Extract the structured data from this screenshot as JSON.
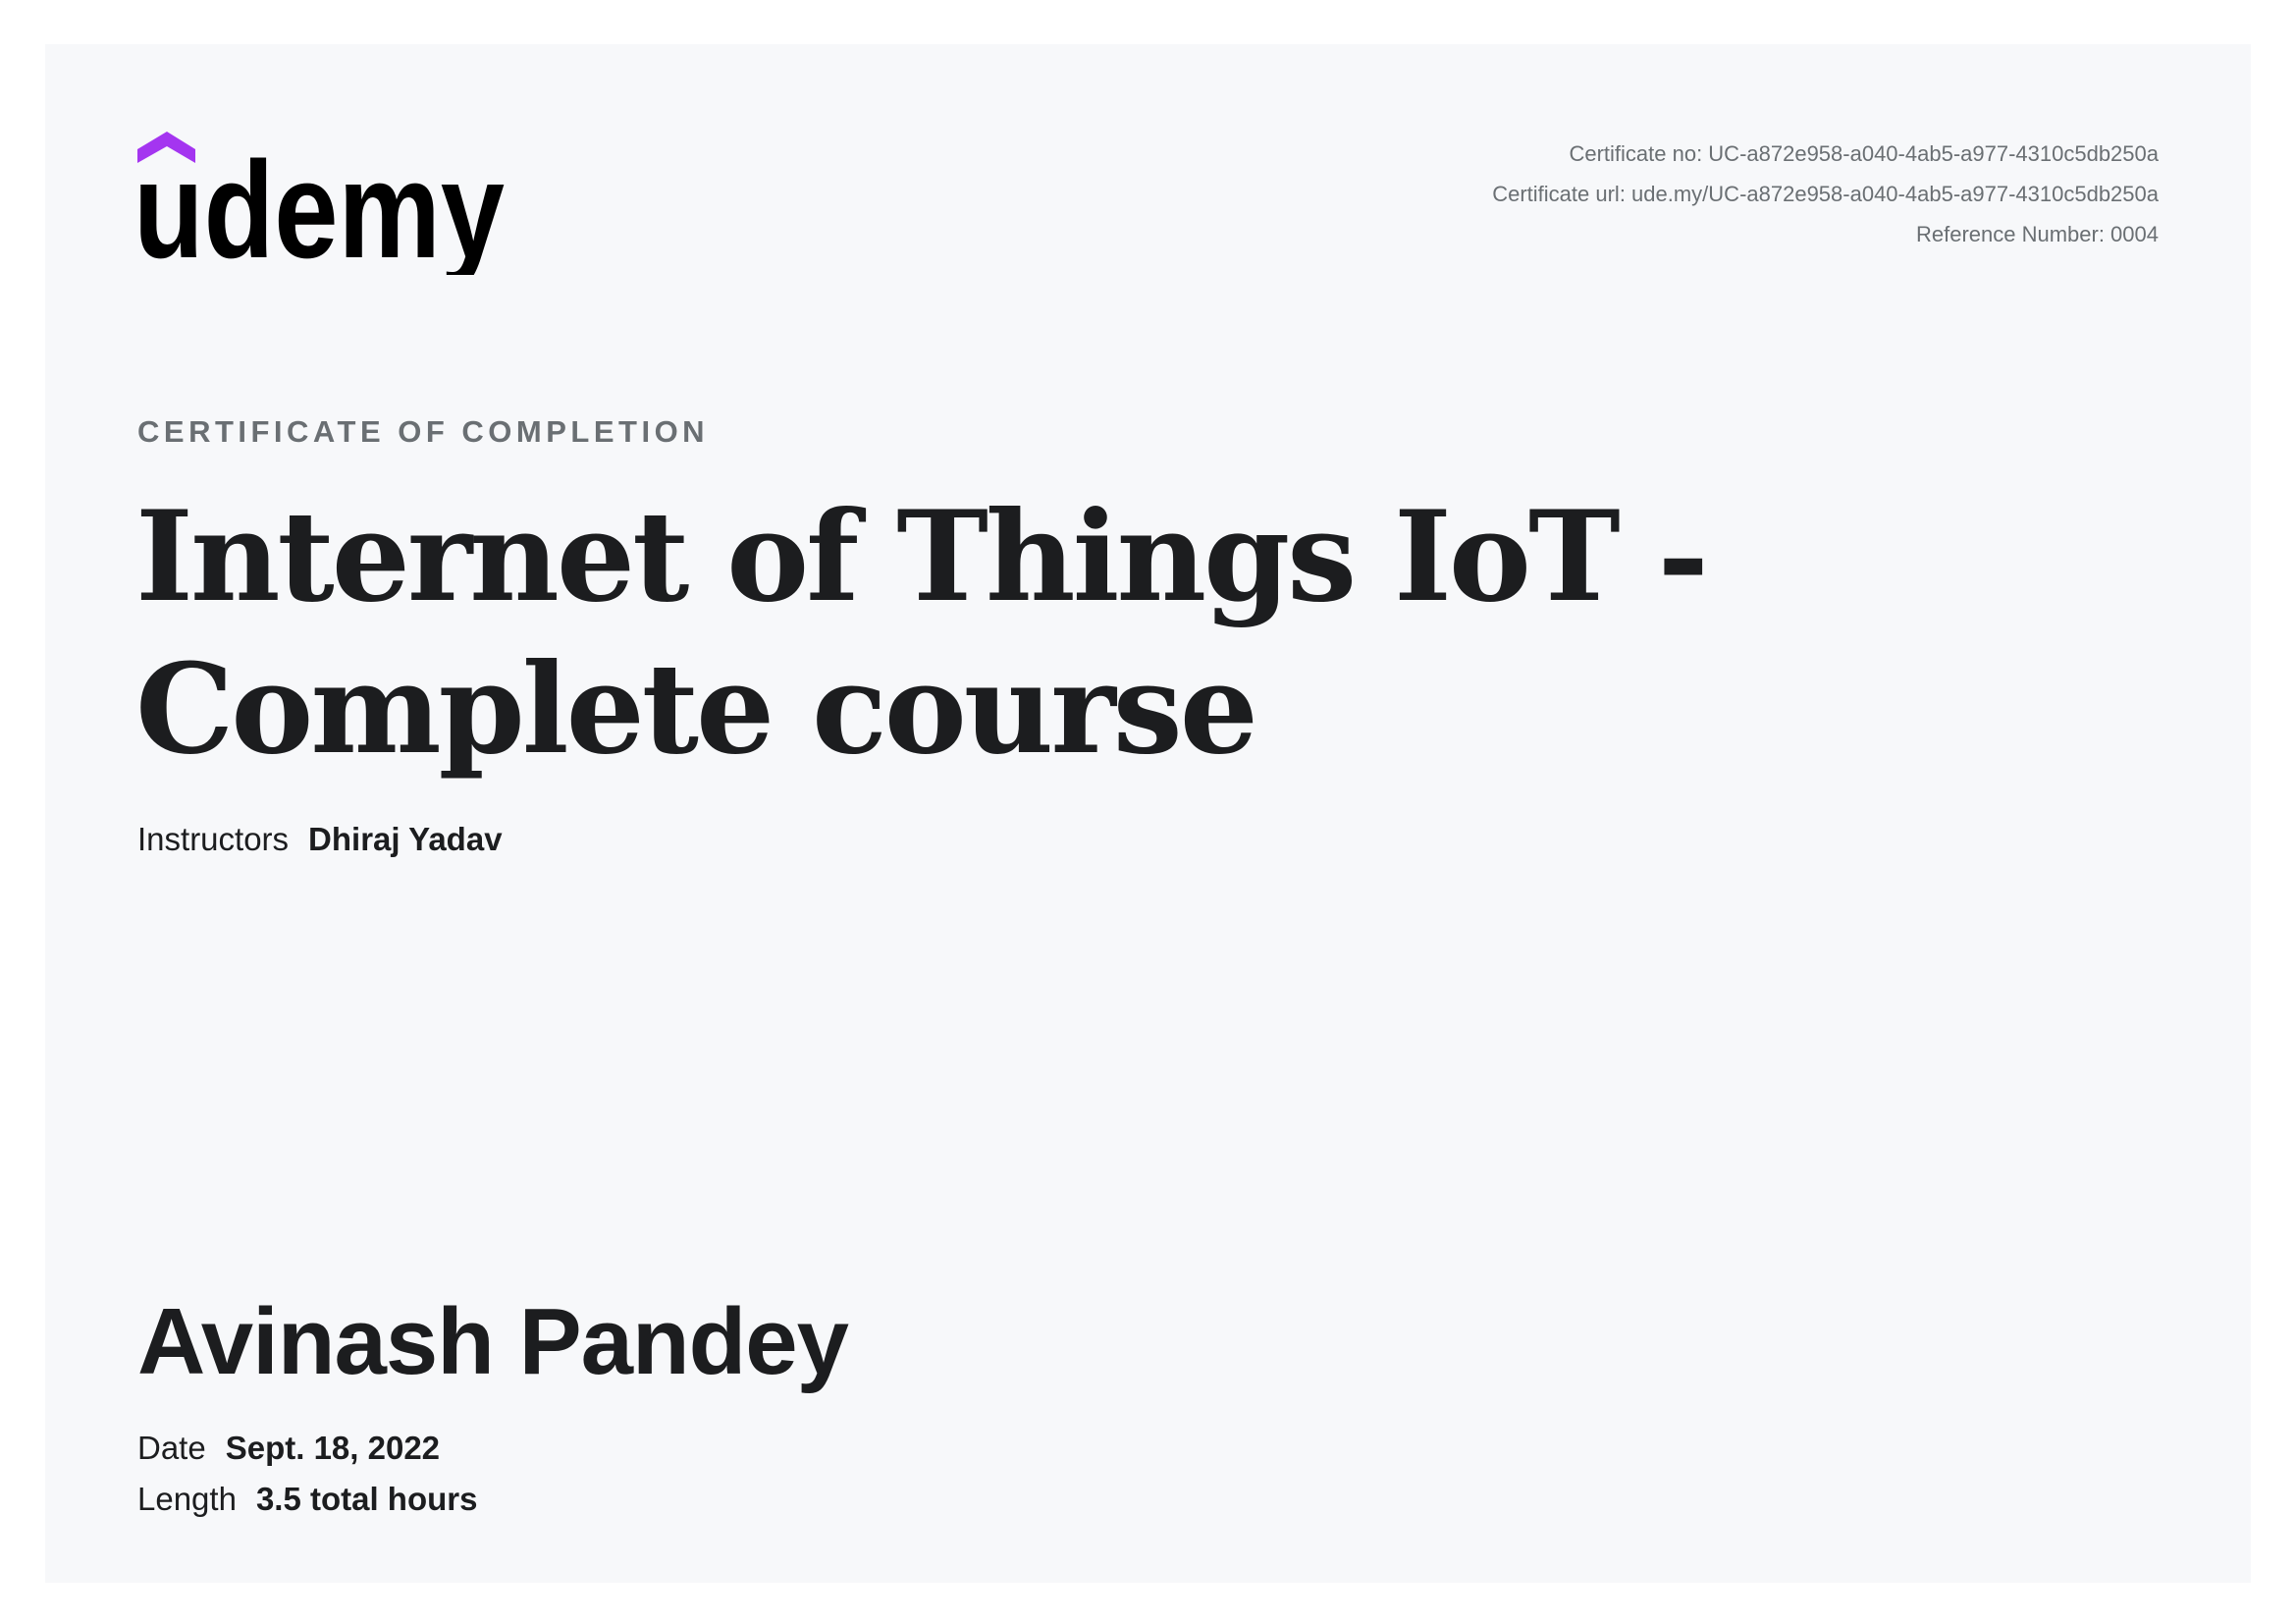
{
  "brand": {
    "name": "udemy",
    "accent_color": "#a435f0"
  },
  "meta": {
    "certificate_no": "Certificate no: UC-a872e958-a040-4ab5-a977-4310c5db250a",
    "certificate_url": "Certificate url: ude.my/UC-a872e958-a040-4ab5-a977-4310c5db250a",
    "reference_number": "Reference Number: 0004"
  },
  "certificate": {
    "label": "CERTIFICATE OF COMPLETION",
    "title_line1": "Internet of Things IoT -",
    "title_line2": "Complete course",
    "instructors_label": "Instructors",
    "instructors": "Dhiraj Yadav",
    "student_name": "Avinash Pandey",
    "date_label": "Date",
    "date": "Sept. 18, 2022",
    "length_label": "Length",
    "length": "3.5 total hours"
  }
}
